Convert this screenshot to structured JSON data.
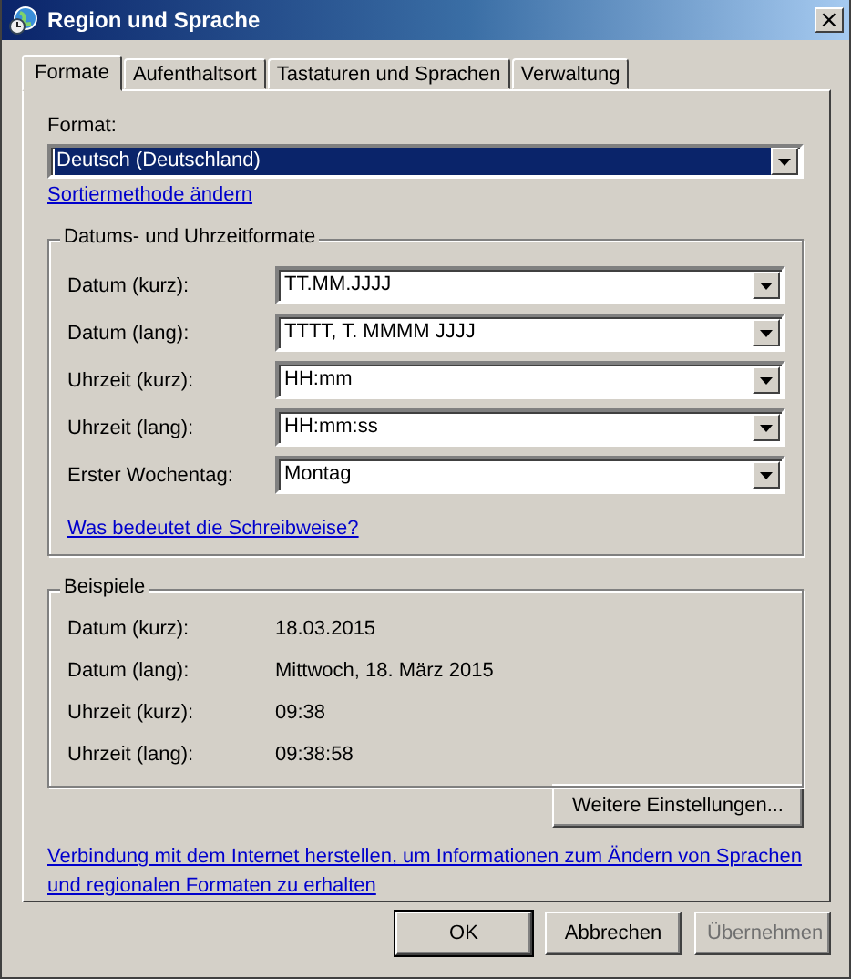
{
  "window": {
    "title": "Region und Sprache",
    "close": "×"
  },
  "tabs": [
    {
      "label": "Formate",
      "selected": true
    },
    {
      "label": "Aufenthaltsort",
      "selected": false
    },
    {
      "label": "Tastaturen und Sprachen",
      "selected": false
    },
    {
      "label": "Verwaltung",
      "selected": false
    }
  ],
  "format": {
    "label": "Format:",
    "value": "Deutsch (Deutschland)",
    "focused": true
  },
  "sort_link": "Sortiermethode ändern",
  "formats_group": {
    "title": "Datums- und Uhrzeitformate",
    "rows": [
      {
        "label": "Datum (kurz):",
        "value": "TT.MM.JJJJ"
      },
      {
        "label": "Datum (lang):",
        "value": "TTTT, T. MMMM JJJJ"
      },
      {
        "label": "Uhrzeit (kurz):",
        "value": "HH:mm"
      },
      {
        "label": "Uhrzeit (lang):",
        "value": "HH:mm:ss"
      },
      {
        "label": "Erster Wochentag:",
        "value": "Montag"
      }
    ],
    "link": "Was bedeutet die Schreibweise?"
  },
  "examples_group": {
    "title": "Beispiele",
    "rows": [
      {
        "label": "Datum (kurz):",
        "value": "18.03.2015"
      },
      {
        "label": "Datum (lang):",
        "value": "Mittwoch, 18. März 2015"
      },
      {
        "label": "Uhrzeit (kurz):",
        "value": "09:38"
      },
      {
        "label": "Uhrzeit (lang):",
        "value": "09:38:58"
      }
    ]
  },
  "more_button": "Weitere Einstellungen...",
  "internet_link": "Verbindung mit dem Internet herstellen, um Informationen zum Ändern von Sprachen und regionalen Formaten zu erhalten",
  "buttons": [
    {
      "label": "OK",
      "disabled": false,
      "default": true
    },
    {
      "label": "Abbrechen",
      "disabled": false,
      "default": false
    },
    {
      "label": "Übernehmen",
      "disabled": true,
      "default": false
    }
  ]
}
